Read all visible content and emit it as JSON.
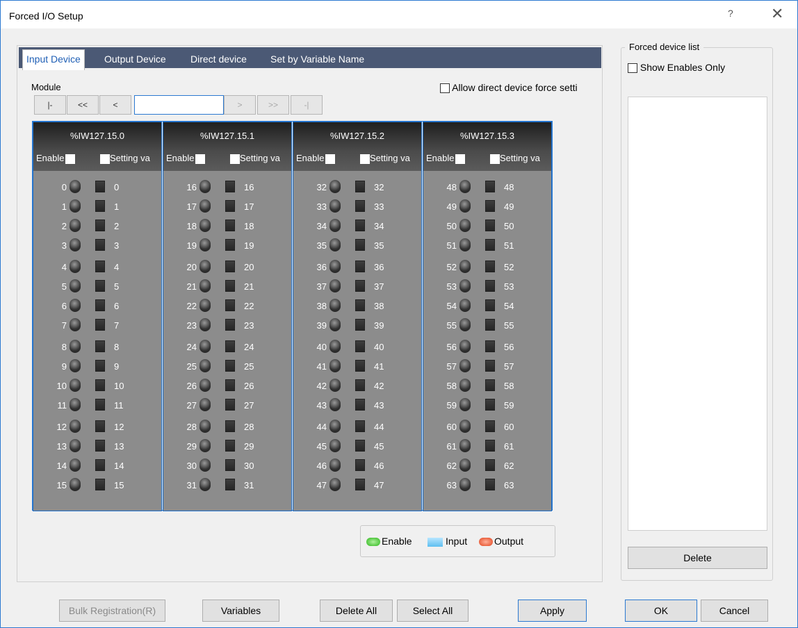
{
  "window": {
    "title": "Forced I/O Setup",
    "help_glyph": "?",
    "close_glyph": "✕"
  },
  "tabs": [
    {
      "label": "Input Device",
      "active": true
    },
    {
      "label": "Output Device",
      "active": false
    },
    {
      "label": "Direct device",
      "active": false
    },
    {
      "label": "Set by Variable Name",
      "active": false
    }
  ],
  "module_nav": {
    "label": "Module",
    "first": "|-",
    "prev_fast": "<<",
    "prev": "<",
    "input_value": "",
    "next": ">",
    "next_fast": ">>",
    "last": "-|"
  },
  "allow_direct": {
    "label": "Allow direct device force setti",
    "checked": false
  },
  "modules": [
    {
      "name": "%IW127.15.0",
      "enable_label": "Enable",
      "setting_label": "Setting va",
      "start": 0
    },
    {
      "name": "%IW127.15.1",
      "enable_label": "Enable",
      "setting_label": "Setting va",
      "start": 16
    },
    {
      "name": "%IW127.15.2",
      "enable_label": "Enable",
      "setting_label": "Setting va",
      "start": 32
    },
    {
      "name": "%IW127.15.3",
      "enable_label": "Enable",
      "setting_label": "Setting va",
      "start": 48
    }
  ],
  "legend": {
    "enable": "Enable",
    "input": "Input",
    "output": "Output",
    "colors": {
      "enable": "#2cb51a",
      "input": "#5dbef0",
      "output": "#e2431c"
    }
  },
  "forced_list": {
    "title": "Forced device list",
    "show_enables_label": "Show Enables Only",
    "show_enables_checked": false,
    "delete_label": "Delete"
  },
  "buttons": {
    "bulk": "Bulk Registration(R)",
    "variables": "Variables",
    "delete_all": "Delete All",
    "select_all": "Select All",
    "apply": "Apply",
    "ok": "OK",
    "cancel": "Cancel"
  },
  "colors": {
    "tab_bar": "#4b5975",
    "module_bg": "#8c8c8c",
    "accent": "#2b79d1"
  }
}
